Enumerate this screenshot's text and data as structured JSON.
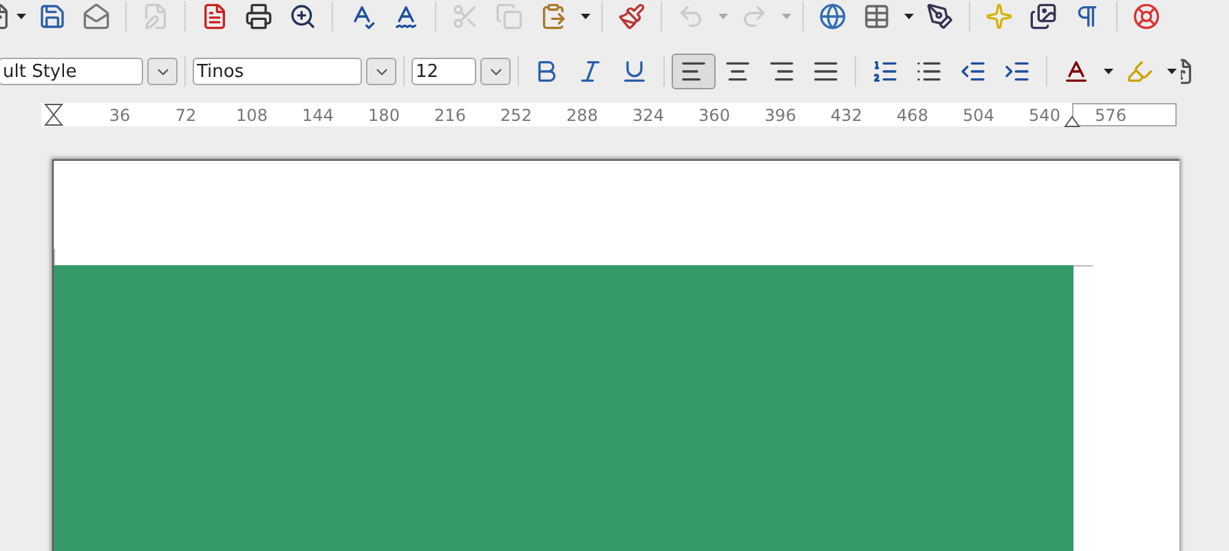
{
  "toolbar_standard": [
    {
      "kind": "partial",
      "disabled": false
    },
    {
      "kind": "arrow",
      "disabled": false
    },
    {
      "kind": "save",
      "disabled": false
    },
    {
      "kind": "mail",
      "disabled": false
    },
    {
      "kind": "separator"
    },
    {
      "kind": "edit",
      "disabled": true
    },
    {
      "kind": "separator"
    },
    {
      "kind": "pdf",
      "disabled": false
    },
    {
      "kind": "print",
      "disabled": false
    },
    {
      "kind": "preview",
      "disabled": false
    },
    {
      "kind": "separator"
    },
    {
      "kind": "spell",
      "disabled": false
    },
    {
      "kind": "autospell",
      "disabled": false
    },
    {
      "kind": "separator"
    },
    {
      "kind": "cut",
      "disabled": true
    },
    {
      "kind": "copy",
      "disabled": true
    },
    {
      "kind": "paste",
      "disabled": false
    },
    {
      "kind": "arrow",
      "disabled": false
    },
    {
      "kind": "separator"
    },
    {
      "kind": "brush",
      "disabled": false
    },
    {
      "kind": "separator"
    },
    {
      "kind": "undo",
      "disabled": true
    },
    {
      "kind": "arrow",
      "disabled": true
    },
    {
      "kind": "redo",
      "disabled": true
    },
    {
      "kind": "arrow",
      "disabled": true
    },
    {
      "kind": "separator"
    },
    {
      "kind": "navigator",
      "disabled": false
    },
    {
      "kind": "table",
      "disabled": false
    },
    {
      "kind": "arrow",
      "disabled": false
    },
    {
      "kind": "draw",
      "disabled": false
    },
    {
      "kind": "separator"
    },
    {
      "kind": "star",
      "disabled": false
    },
    {
      "kind": "gallery",
      "disabled": false
    },
    {
      "kind": "pilcrow",
      "disabled": false
    },
    {
      "kind": "separator"
    },
    {
      "kind": "help",
      "disabled": false
    }
  ],
  "toolbar_formatting": {
    "paragraph_style": {
      "value": "ult Style"
    },
    "font_name": {
      "value": "Tinos"
    },
    "font_size": {
      "value": "12"
    },
    "buttons": [
      {
        "kind": "bold"
      },
      {
        "kind": "italic"
      },
      {
        "kind": "underline"
      },
      {
        "kind": "separator"
      },
      {
        "kind": "align-left",
        "selected": true
      },
      {
        "kind": "align-center",
        "selected": false
      },
      {
        "kind": "align-right",
        "selected": false
      },
      {
        "kind": "align-justify",
        "selected": false
      },
      {
        "kind": "separator"
      },
      {
        "kind": "numbering"
      },
      {
        "kind": "bullets"
      },
      {
        "kind": "outdent"
      },
      {
        "kind": "indent"
      },
      {
        "kind": "separator"
      },
      {
        "kind": "font-color"
      },
      {
        "kind": "arrow"
      },
      {
        "kind": "highlight"
      },
      {
        "kind": "arrow"
      },
      {
        "kind": "partial"
      }
    ]
  },
  "ruler": {
    "labels": [
      "36",
      "72",
      "108",
      "144",
      "180",
      "216",
      "252",
      "288",
      "324",
      "360",
      "396",
      "432",
      "468",
      "504",
      "540",
      "576"
    ]
  }
}
